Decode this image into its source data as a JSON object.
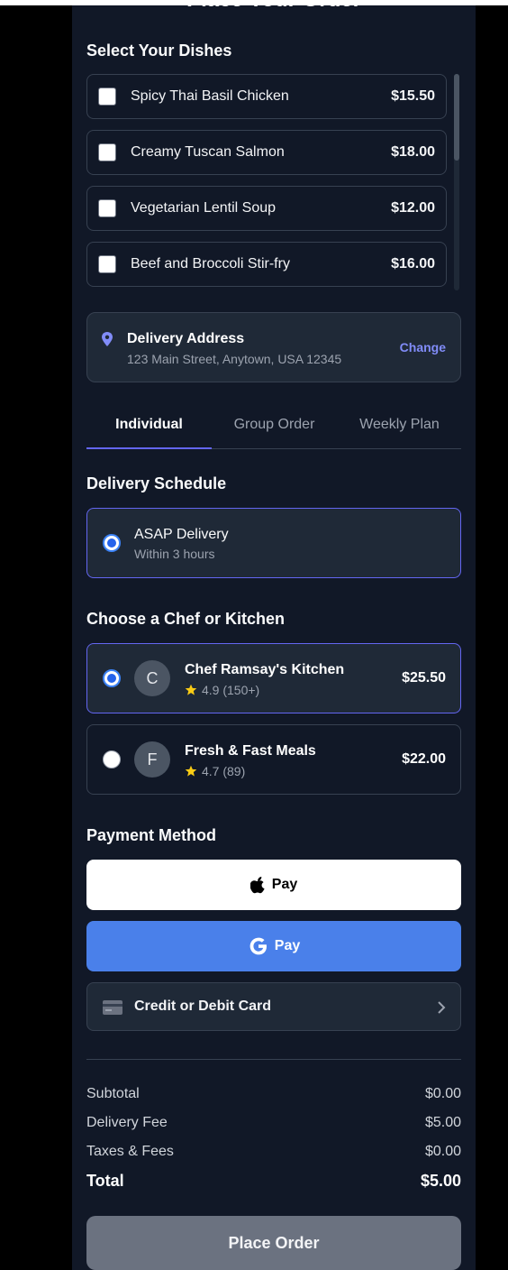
{
  "header": {
    "title": "Place Your Order"
  },
  "dishes": {
    "section_title": "Select Your Dishes",
    "items": [
      {
        "name": "Spicy Thai Basil Chicken",
        "price": "$15.50",
        "checked": false
      },
      {
        "name": "Creamy Tuscan Salmon",
        "price": "$18.00",
        "checked": false
      },
      {
        "name": "Vegetarian Lentil Soup",
        "price": "$12.00",
        "checked": false
      },
      {
        "name": "Beef and Broccoli Stir-fry",
        "price": "$16.00",
        "checked": false
      }
    ]
  },
  "address": {
    "title": "Delivery Address",
    "line": "123 Main Street, Anytown, USA 12345",
    "change_label": "Change"
  },
  "tabs": [
    {
      "label": "Individual",
      "active": true
    },
    {
      "label": "Group Order",
      "active": false
    },
    {
      "label": "Weekly Plan",
      "active": false
    }
  ],
  "schedule": {
    "section_title": "Delivery Schedule",
    "option": {
      "title": "ASAP Delivery",
      "subtitle": "Within 3 hours",
      "selected": true
    }
  },
  "chefs": {
    "section_title": "Choose a Chef or Kitchen",
    "items": [
      {
        "initial": "C",
        "name": "Chef Ramsay's Kitchen",
        "rating": "4.9 (150+)",
        "price": "$25.50",
        "selected": true
      },
      {
        "initial": "F",
        "name": "Fresh & Fast Meals",
        "rating": "4.7 (89)",
        "price": "$22.00",
        "selected": false
      }
    ]
  },
  "payment": {
    "section_title": "Payment Method",
    "apple_pay_label": "Pay",
    "google_pay_label": "Pay",
    "card_label": "Credit or Debit Card"
  },
  "summary": {
    "subtotal_label": "Subtotal",
    "subtotal": "$0.00",
    "delivery_label": "Delivery Fee",
    "delivery": "$5.00",
    "taxes_label": "Taxes & Fees",
    "taxes": "$0.00",
    "total_label": "Total",
    "total": "$5.00"
  },
  "place_order_label": "Place Order",
  "colors": {
    "background": "#111827",
    "card": "#1f2937",
    "accent": "#6366f1",
    "google_pay": "#4a80ea",
    "disabled_button": "#6b7280",
    "star": "#facc15"
  }
}
